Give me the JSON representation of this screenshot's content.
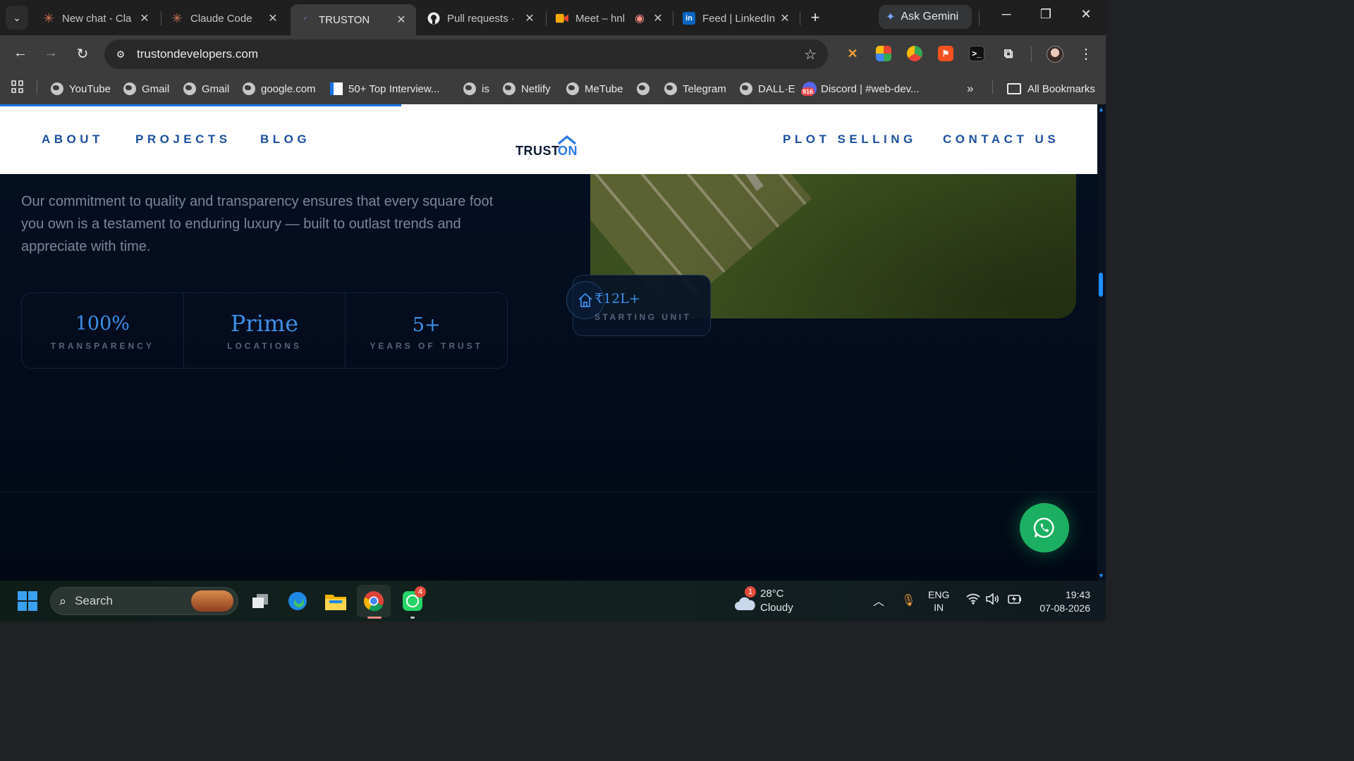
{
  "browser": {
    "tabs": [
      {
        "title": "New chat - Cla",
        "icon": "claude-icon"
      },
      {
        "title": "Claude Code",
        "icon": "claude-icon"
      },
      {
        "title": "TRUSTON",
        "icon": "loading-icon",
        "active": true
      },
      {
        "title": "Pull requests ·",
        "icon": "github-icon"
      },
      {
        "title": "Meet – hnl",
        "icon": "meet-icon"
      },
      {
        "title": "Feed | LinkedIn",
        "icon": "linkedin-icon"
      }
    ],
    "gemini_label": "Ask Gemini",
    "url": "trustondevelopers.com",
    "bookmarks": [
      {
        "label": "YouTube"
      },
      {
        "label": "Gmail"
      },
      {
        "label": "Gmail"
      },
      {
        "label": "google.com"
      },
      {
        "label": "50+ Top Interview..."
      },
      {
        "label": "is"
      },
      {
        "label": "Netlify"
      },
      {
        "label": "MeTube"
      },
      {
        "label": ""
      },
      {
        "label": "Telegram"
      },
      {
        "label": "DALL·E"
      },
      {
        "label": "Discord | #web-dev..."
      }
    ],
    "all_bookmarks_label": "All Bookmarks",
    "discord_badge": "916"
  },
  "site": {
    "nav_left": [
      "ABOUT",
      "PROJECTS",
      "BLOG"
    ],
    "nav_right": [
      "PLOT SELLING",
      "CONTACT US"
    ],
    "logo": {
      "part1": "TRUST",
      "part2": "ON"
    },
    "description": "Our commitment to quality and transparency ensures that every square foot you own is a testament to enduring luxury — built to outlast trends and appreciate with time.",
    "stats": [
      {
        "value": "100%",
        "label": "TRANSPARENCY"
      },
      {
        "value": "Prime",
        "label": "LOCATIONS"
      },
      {
        "value": "5+",
        "label": "YEARS OF TRUST"
      }
    ],
    "badge": {
      "value": "₹12L+",
      "label": "STARTING UNIT"
    },
    "colors": {
      "accent": "#3d8fe8",
      "nav": "#1b4fa0",
      "background": "#041022",
      "whatsapp": "#1bb061"
    }
  },
  "taskbar": {
    "search_placeholder": "Search",
    "whatsapp_badge": "4",
    "weather": {
      "temp": "28°C",
      "condition": "Cloudy",
      "alert": "1"
    },
    "lang": {
      "line1": "ENG",
      "line2": "IN"
    },
    "clock": {
      "time": "19:43",
      "date": "07-08-2026"
    }
  }
}
